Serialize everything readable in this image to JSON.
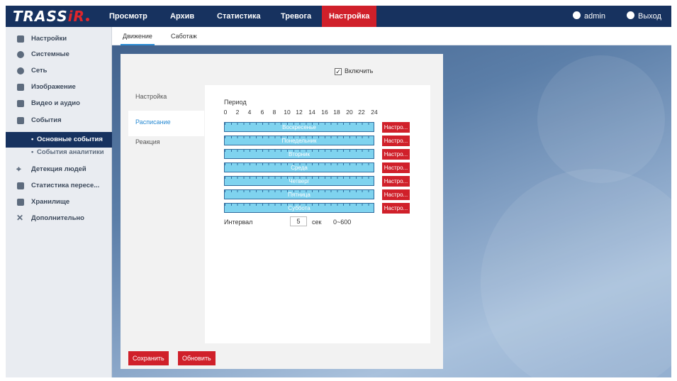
{
  "app": {
    "logo": "TRASS",
    "logo_accent": "iR"
  },
  "nav": {
    "items": [
      {
        "label": "Просмотр"
      },
      {
        "label": "Архив"
      },
      {
        "label": "Статистика"
      },
      {
        "label": "Тревога"
      },
      {
        "label": "Настройка"
      }
    ],
    "active_index": 4
  },
  "user": {
    "name": "admin",
    "logout": "Выход"
  },
  "sidebar": {
    "items": [
      {
        "label": "Настройки",
        "icon": "monitor-icon"
      },
      {
        "label": "Системные",
        "icon": "info-icon"
      },
      {
        "label": "Сеть",
        "icon": "globe-icon"
      },
      {
        "label": "Изображение",
        "icon": "image-icon"
      },
      {
        "label": "Видео и аудио",
        "icon": "video-icon"
      },
      {
        "label": "События",
        "icon": "event-icon"
      },
      {
        "label": "Основные события",
        "icon": ""
      },
      {
        "label": "События аналитики",
        "icon": ""
      },
      {
        "label": "Детекция людей",
        "icon": "person-detect-icon"
      },
      {
        "label": "Статистика пересе...",
        "icon": "stats-icon"
      },
      {
        "label": "Хранилище",
        "icon": "storage-icon"
      },
      {
        "label": "Дополнительно",
        "icon": "tools-icon"
      }
    ]
  },
  "subtabs": [
    {
      "label": "Движение"
    },
    {
      "label": "Саботаж"
    }
  ],
  "enable": {
    "label": "Включить",
    "checked": true
  },
  "innertabs": [
    {
      "label": "Настройка"
    },
    {
      "label": "Расписание"
    },
    {
      "label": "Реакция"
    }
  ],
  "schedule": {
    "period_label": "Период",
    "hours": [
      "0",
      "2",
      "4",
      "6",
      "8",
      "10",
      "12",
      "14",
      "16",
      "18",
      "20",
      "22",
      "24"
    ],
    "days": [
      {
        "name": "Воскресенье"
      },
      {
        "name": "Понедельник"
      },
      {
        "name": "Вторник"
      },
      {
        "name": "Среда"
      },
      {
        "name": "Четверг"
      },
      {
        "name": "Пятница"
      },
      {
        "name": "Суббота"
      }
    ],
    "set_label": "Настро..."
  },
  "interval": {
    "label": "Интервал",
    "value": "5",
    "unit": "сек",
    "range": "0~600"
  },
  "buttons": {
    "save": "Сохранить",
    "refresh": "Обновить"
  },
  "colors": {
    "accent": "#d0202a",
    "header": "#17325f",
    "schedule_fill": "#7fd3ef",
    "link": "#2a8bd3"
  }
}
